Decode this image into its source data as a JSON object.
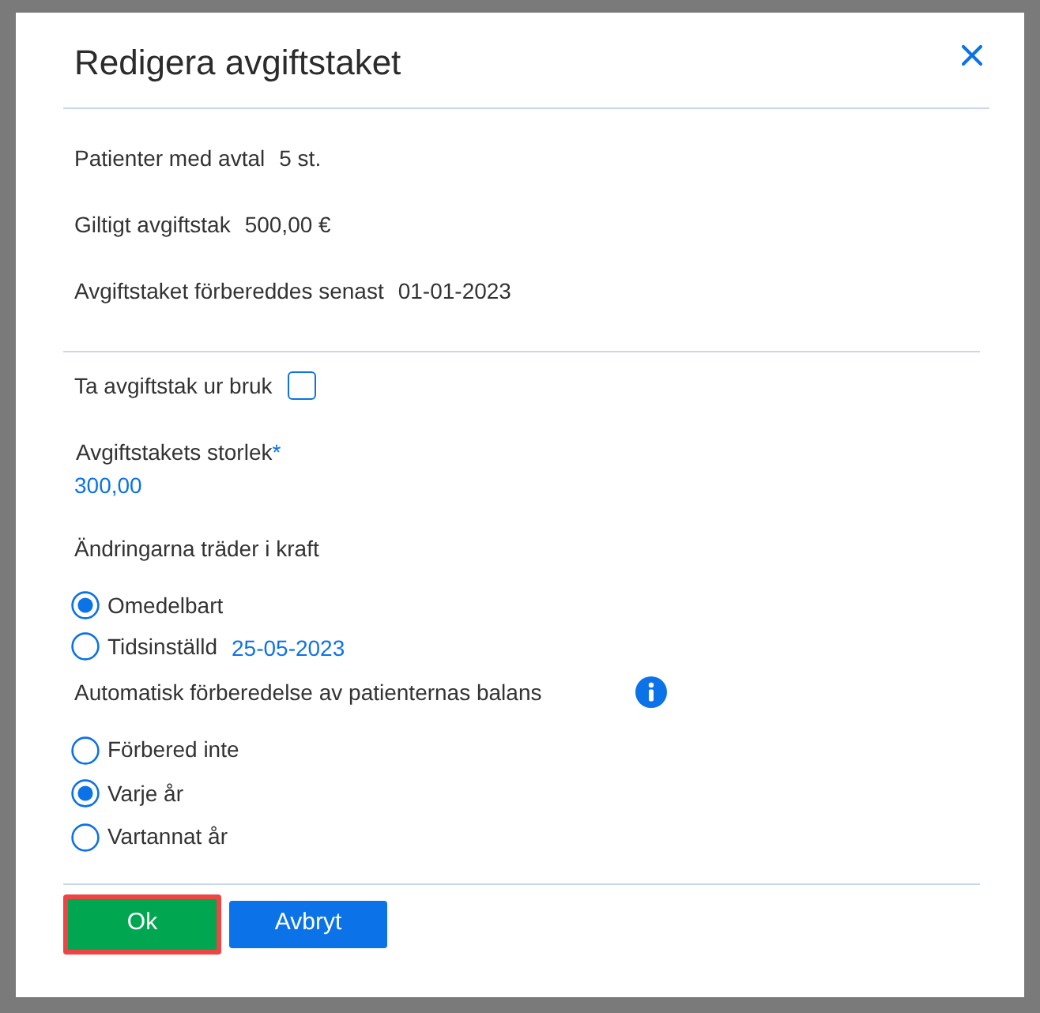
{
  "dialog": {
    "title": "Redigera avgiftstaket"
  },
  "info_rows": [
    {
      "label": "Patienter med avtal",
      "value": "5 st."
    },
    {
      "label": "Giltigt avgiftstak",
      "value": "500,00 €"
    },
    {
      "label": "Avgiftstaket förbereddes senast",
      "value": "01-01-2023"
    }
  ],
  "disable_toggle": {
    "label": "Ta avgiftstak ur bruk",
    "checked": false
  },
  "amount_field": {
    "label": "Avgiftstakets storlek",
    "required_mark": "*",
    "value": "300,00"
  },
  "effective": {
    "label": "Ändringarna träder i kraft",
    "options": [
      {
        "label": "Omedelbart",
        "selected": true
      },
      {
        "label": "Tidsinställd",
        "selected": false,
        "date": "25-05-2023"
      }
    ]
  },
  "auto_prepare": {
    "label": "Automatisk förberedelse av patienternas balans",
    "options": [
      {
        "label": "Förbered inte",
        "selected": false
      },
      {
        "label": "Varje år",
        "selected": true
      },
      {
        "label": "Vartannat år",
        "selected": false
      }
    ]
  },
  "buttons": [
    {
      "label": "Ok",
      "kind": "confirm",
      "highlighted": true
    },
    {
      "label": "Avbryt",
      "kind": "cancel",
      "highlighted": false
    }
  ]
}
